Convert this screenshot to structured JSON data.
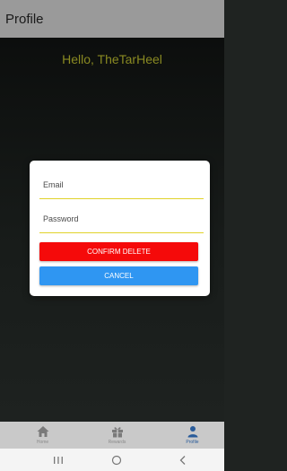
{
  "header": {
    "title": "Profile"
  },
  "main": {
    "greeting": "Hello, TheTarHeel"
  },
  "dialog": {
    "email_placeholder": "Email",
    "password_placeholder": "Password",
    "confirm_label": "CONFIRM DELETE",
    "cancel_label": "CANCEL"
  },
  "tabs": [
    {
      "label": "Home",
      "icon": "home-icon"
    },
    {
      "label": "Rewards",
      "icon": "gift-icon"
    },
    {
      "label": "Profile",
      "icon": "person-icon"
    }
  ],
  "system_nav": [
    "recents-icon",
    "home-circle-icon",
    "back-icon"
  ],
  "colors": {
    "accent_yellow": "#e0d22a",
    "delete_red": "#f50a0a",
    "cancel_blue": "#2f96f2",
    "active_tab": "#2a5c9a"
  }
}
